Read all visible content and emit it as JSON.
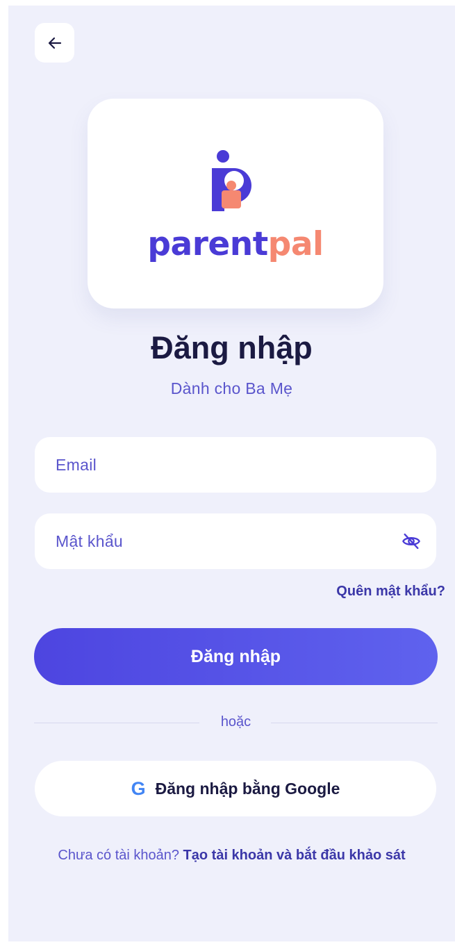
{
  "header": {
    "back_icon": "arrow-left-icon"
  },
  "brand": {
    "logo_icon": "parentpal-logo-mark",
    "name_part1": "parent",
    "name_part2": "pal",
    "colors": {
      "primary": "#4a3bd6",
      "accent": "#f58871"
    }
  },
  "page": {
    "title": "Đăng nhập",
    "subtitle": "Dành cho Ba Mẹ"
  },
  "form": {
    "email": {
      "value": "",
      "placeholder": "Email"
    },
    "password": {
      "value": "",
      "placeholder": "Mật khẩu",
      "toggle_icon": "eye-off-icon"
    },
    "forgot_password": "Quên mật khẩu?",
    "submit_label": "Đăng nhập"
  },
  "divider": {
    "text": "hoặc"
  },
  "google": {
    "icon_letter": "G",
    "label": "Đăng nhập bằng Google"
  },
  "signup": {
    "prompt": "Chưa có tài khoản?",
    "link": "Tạo tài khoản và bắt đầu khảo sát"
  },
  "theme": {
    "background": "#eff0fb",
    "button_gradient_start": "#4d45e0",
    "button_gradient_end": "#5f62ee",
    "google_blue": "#4285f4"
  }
}
